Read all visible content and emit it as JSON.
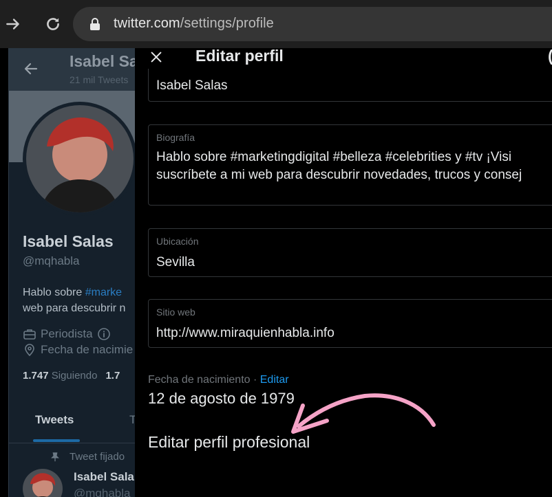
{
  "browser": {
    "url_host": "twitter.com",
    "url_path": "/settings/profile"
  },
  "profile": {
    "header_name": "Isabel Salas",
    "header_count": "21 mil Tweets",
    "name": "Isabel Salas",
    "handle": "@mqhabla",
    "bio_line1_prefix": "Hablo sobre ",
    "bio_line1_tag": "#marke",
    "bio_line2": "web para descubrir n",
    "occupation": "Periodista",
    "birth_label": "Fecha de nacimie",
    "following_count": "1.747",
    "following_label": "Siguiendo",
    "followers_count": "1.7",
    "tab_tweets": "Tweets",
    "tab_other": "T",
    "pinned_label": "Tweet fijado",
    "tweet_author": "Isabel Sala",
    "tweet_handle": "@mqhabla"
  },
  "modal": {
    "title": "Editar perfil",
    "save_partial": "(",
    "name_value": "Isabel Salas",
    "bio_label": "Biografía",
    "bio_line1": "Hablo sobre #marketingdigital  #belleza #celebrities y #tv ¡Visi",
    "bio_line2": "suscríbete a mi web para descubrir novedades, trucos y consej",
    "location_label": "Ubicación",
    "location_value": "Sevilla",
    "website_label": "Sitio web",
    "website_value": "http://www.miraquienhabla.info",
    "dob_label": "Fecha de nacimiento · ",
    "dob_edit": "Editar",
    "dob_value": "12 de agosto de 1979",
    "professional_link": "Editar perfil profesional"
  },
  "colors": {
    "accent": "#1d9bf0",
    "annotation": "#f5a3c7"
  },
  "icons": [
    "forward-arrow-icon",
    "reload-icon",
    "lock-icon",
    "back-arrow-icon",
    "close-icon",
    "briefcase-icon",
    "info-icon",
    "location-pin-icon",
    "pin-icon"
  ]
}
